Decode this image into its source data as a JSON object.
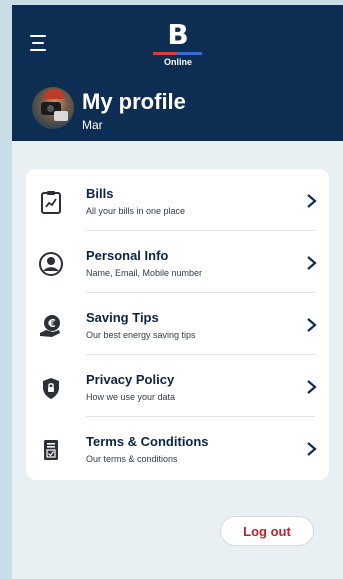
{
  "header": {
    "logo_letter": "B",
    "logo_subtitle": "Online",
    "title": "My profile",
    "user_name": "Mar"
  },
  "menu": {
    "items": [
      {
        "title": "Bills",
        "subtitle": "All your bills in one place",
        "icon": "clipboard-chart-icon"
      },
      {
        "title": "Personal Info",
        "subtitle": "Name, Email, Mobile number",
        "icon": "user-circle-icon"
      },
      {
        "title": "Saving Tips",
        "subtitle": "Our best energy saving tips",
        "icon": "euro-hand-icon"
      },
      {
        "title": "Privacy Policy",
        "subtitle": "How we use your data",
        "icon": "shield-lock-icon"
      },
      {
        "title": "Terms & Conditions",
        "subtitle": "Our terms & conditions",
        "icon": "document-check-icon"
      }
    ]
  },
  "logout_label": "Log out",
  "colors": {
    "header_bg": "#0e2d52",
    "page_bg": "#e9f0f4",
    "accent_red": "#c3202c",
    "logo_red": "#e0393e",
    "logo_blue": "#2f6fd6",
    "text_dark": "#0e2340"
  }
}
